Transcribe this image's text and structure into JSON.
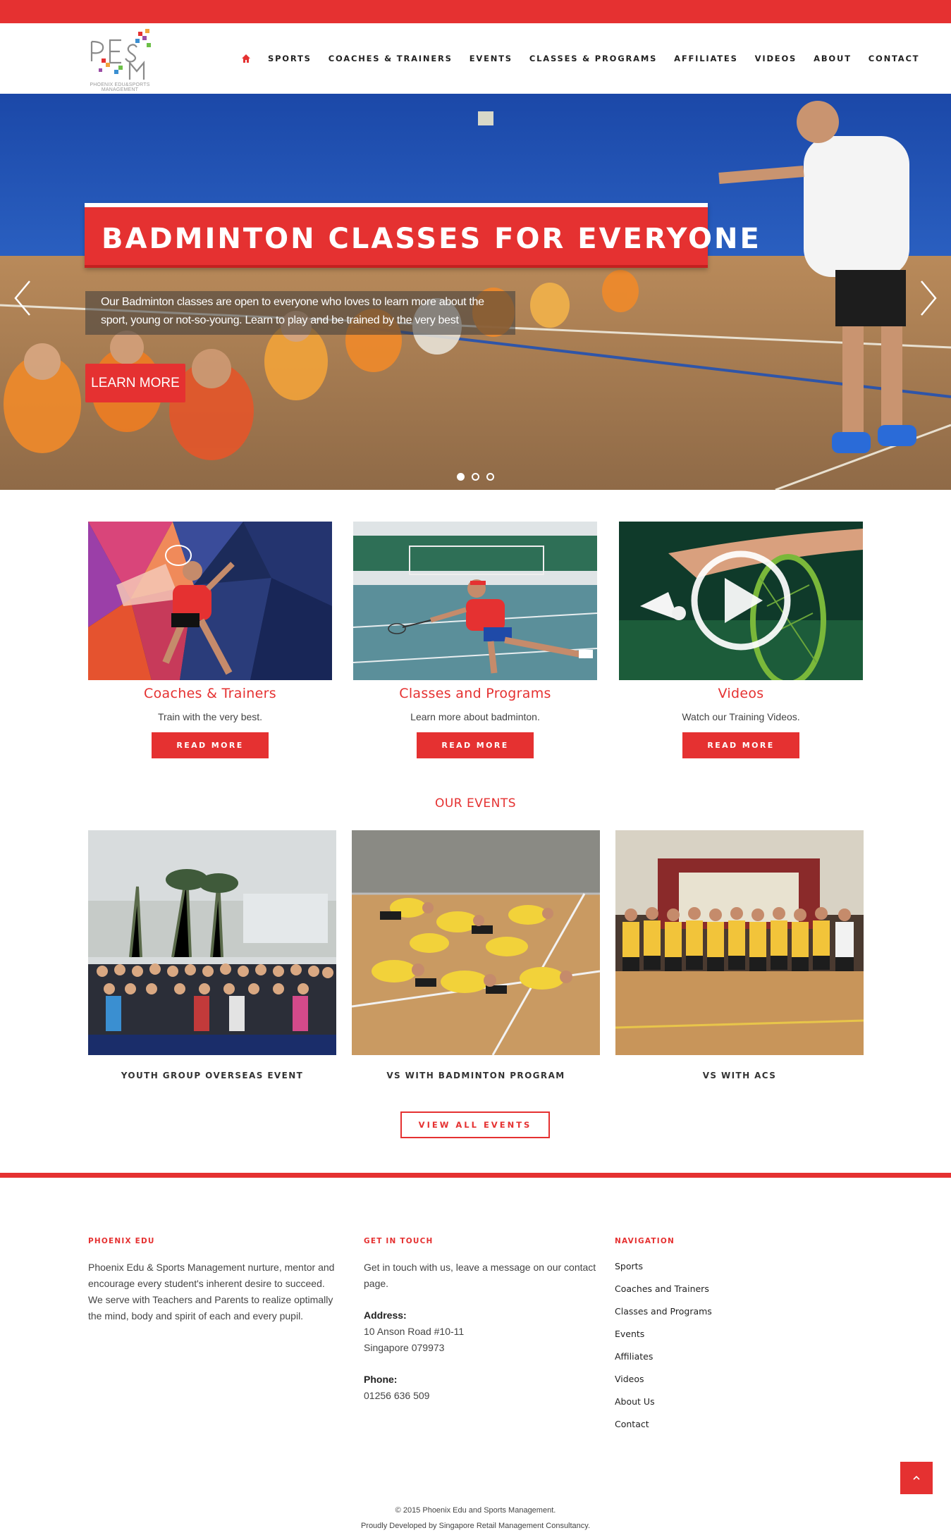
{
  "brand": {
    "logo_letters": "PESM",
    "logo_text": "PHOENIX EDU&SPORTS MANAGEMENT",
    "accent": "#e53131"
  },
  "nav": {
    "home_icon": "home-icon",
    "items": [
      "SPORTS",
      "COACHES & TRAINERS",
      "EVENTS",
      "CLASSES & PROGRAMS",
      "AFFILIATES",
      "VIDEOS",
      "ABOUT",
      "CONTACT"
    ]
  },
  "hero": {
    "title": "BADMINTON CLASSES FOR EVERYONE",
    "description": "Our Badminton classes are open to everyone who loves to learn more about the sport, young or not-so-young. Learn to play and be trained by the very best",
    "button": "LEARN MORE",
    "slides": 3,
    "active_slide": 1
  },
  "features": [
    {
      "title": "Coaches & Trainers",
      "text": "Train with the very best.",
      "button": "READ MORE"
    },
    {
      "title": "Classes and Programs",
      "text": "Learn more about badminton.",
      "button": "READ MORE"
    },
    {
      "title": "Videos",
      "text": "Watch our Training Videos.",
      "button": "READ MORE"
    }
  ],
  "events": {
    "heading": "OUR EVENTS",
    "items": [
      {
        "caption": "YOUTH GROUP OVERSEAS EVENT"
      },
      {
        "caption": "VS WITH BADMINTON PROGRAM"
      },
      {
        "caption": "VS WITH ACS"
      }
    ],
    "view_all": "VIEW ALL EVENTS"
  },
  "footer": {
    "about": {
      "heading": "PHOENIX EDU",
      "text": "Phoenix Edu & Sports Management nurture, mentor and encourage every student's inherent desire to succeed. We serve with Teachers and Parents to realize optimally the mind, body and spirit of each and every pupil."
    },
    "contact": {
      "heading": "GET IN TOUCH",
      "text": "Get in touch with us, leave a message on our contact page.",
      "address_label": "Address:",
      "address_line1": "10 Anson Road #10-11",
      "address_line2": "Singapore 079973",
      "phone_label": "Phone:",
      "phone": "01256 636 509"
    },
    "navigation": {
      "heading": "NAVIGATION",
      "items": [
        "Sports",
        "Coaches and Trainers",
        "Classes and Programs",
        "Events",
        "Affiliates",
        "Videos",
        "About Us",
        "Contact"
      ]
    },
    "copyright": "© 2015 Phoenix Edu and Sports Management.",
    "developer": "Proudly Developed by Singapore Retail Management Consultancy."
  }
}
